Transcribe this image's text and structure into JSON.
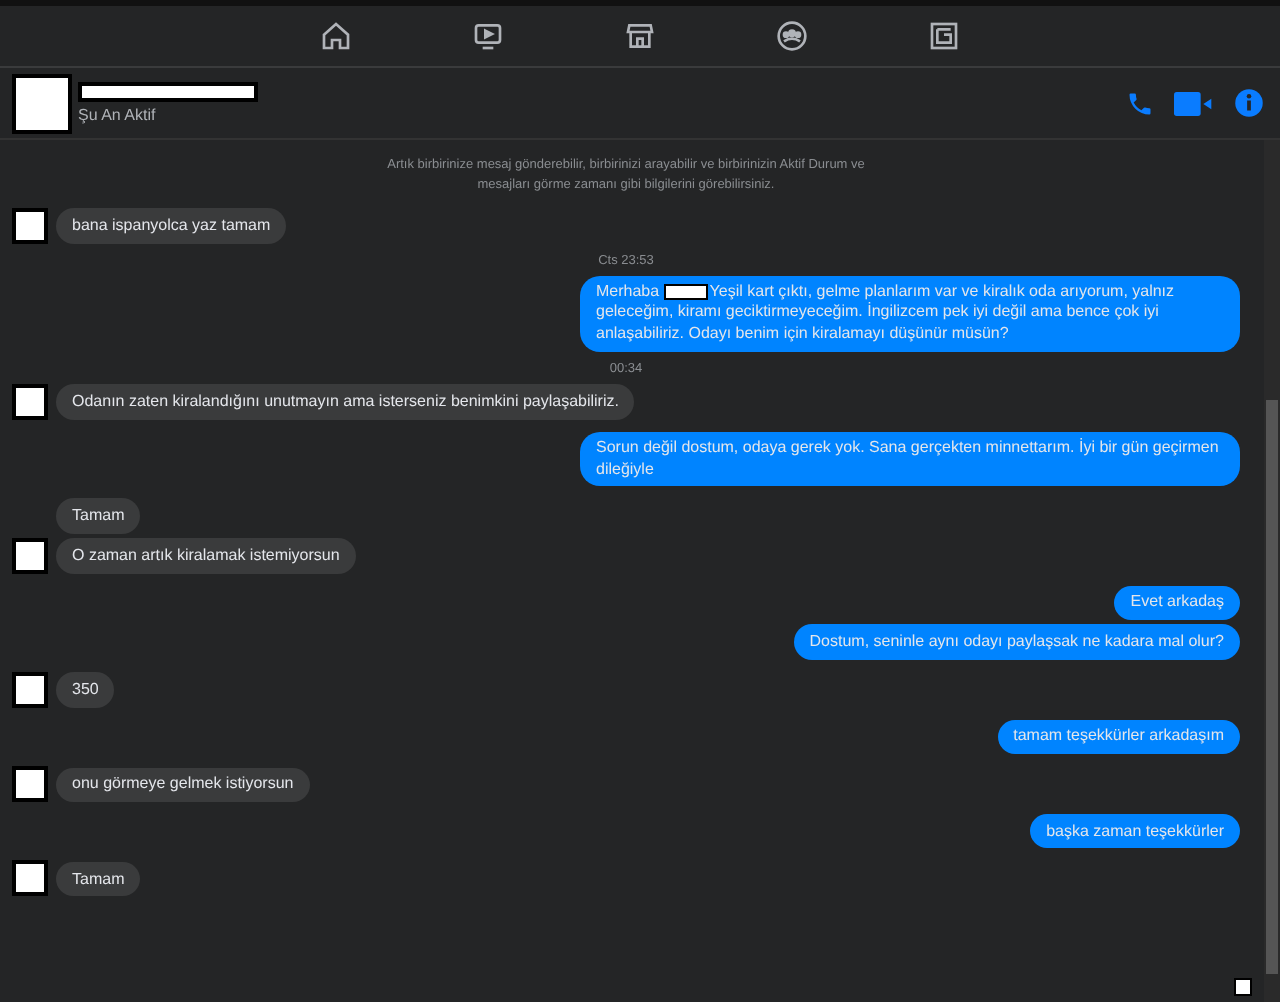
{
  "header": {
    "status": "Şu An Aktif"
  },
  "intro": "Artık birbirinize mesaj gönderebilir, birbirinizi arayabilir ve birbirinizin Aktif Durum ve mesajları görme zamanı gibi bilgilerini görebilirsiniz.",
  "messages": [
    {
      "kind": "incoming",
      "text": "bana ispanyolca yaz tamam",
      "avatar": true
    },
    {
      "kind": "time",
      "text": "Cts 23:53"
    },
    {
      "kind": "outgoing",
      "text": "Merhaba ",
      "redacted": true,
      "rest": "Yeşil kart çıktı, gelme planlarım var ve kiralık oda arıyorum, yalnız geleceğim, kiramı geciktirmeyeceğim. İngilizcem pek iyi değil ama bence çok iyi anlaşabiliriz. Odayı benim için kiralamayı düşünür müsün?"
    },
    {
      "kind": "time",
      "text": "00:34"
    },
    {
      "kind": "incoming",
      "text": "Odanın zaten kiralandığını unutmayın ama isterseniz benimkini paylaşabiliriz.",
      "avatar": true
    },
    {
      "kind": "outgoing",
      "text": "Sorun değil dostum, odaya gerek yok. Sana gerçekten minnettarım. İyi bir gün geçirmen dileğiyle"
    },
    {
      "kind": "incoming",
      "text": "Tamam",
      "avatar": false
    },
    {
      "kind": "incoming",
      "text": "O zaman artık kiralamak istemiyorsun",
      "avatar": true
    },
    {
      "kind": "outgoing",
      "text": "Evet arkadaş"
    },
    {
      "kind": "outgoing",
      "text": "Dostum, seninle aynı odayı paylaşsak ne kadara mal olur?"
    },
    {
      "kind": "incoming",
      "text": "350",
      "avatar": true
    },
    {
      "kind": "outgoing",
      "text": "tamam teşekkürler arkadaşım"
    },
    {
      "kind": "incoming",
      "text": "onu görmeye gelmek istiyorsun",
      "avatar": true
    },
    {
      "kind": "outgoing",
      "text": "başka zaman teşekkürler"
    },
    {
      "kind": "incoming",
      "text": "Tamam",
      "avatar": true
    }
  ],
  "seen_indicator": true
}
